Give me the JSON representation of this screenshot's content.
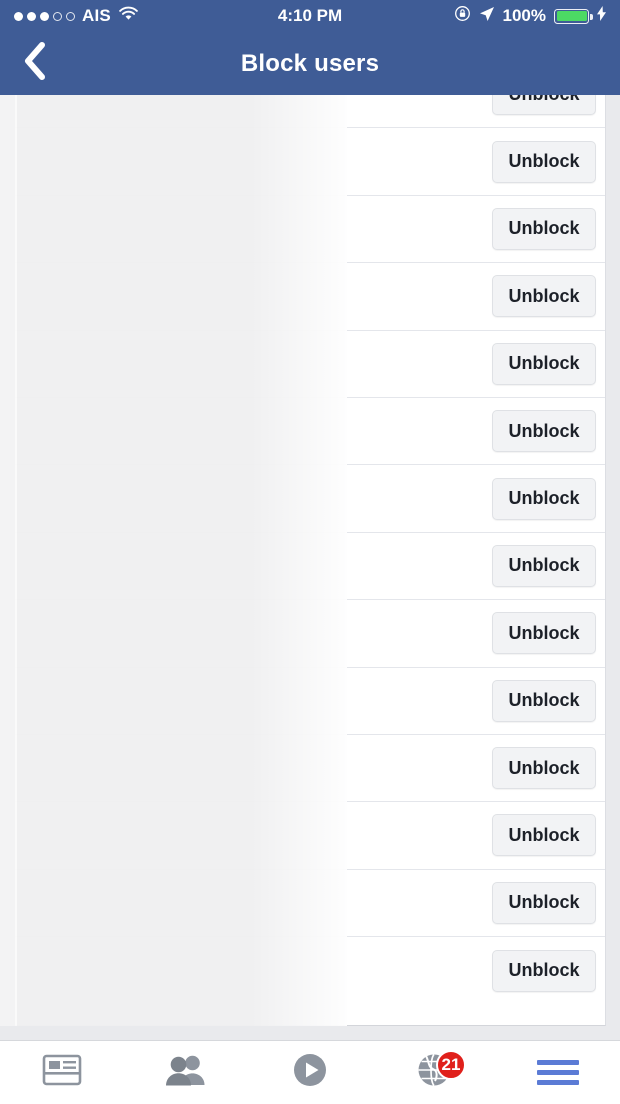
{
  "statusbar": {
    "carrier": "AIS",
    "signal_dots_filled": 3,
    "signal_dots_total": 5,
    "wifi_icon": "wifi-icon",
    "time": "4:10 PM",
    "rotation_lock_icon": "rotation-lock-icon",
    "location_icon": "location-arrow-icon",
    "battery_percent": "100%",
    "battery_level": 100,
    "battery_color": "#4cd964",
    "charging_icon": "lightning-bolt-icon"
  },
  "navbar": {
    "back_icon": "chevron-left-icon",
    "title": "Block users",
    "background_color": "#3f5c96",
    "title_color": "#ffffff"
  },
  "list": {
    "button_label": "Unblock",
    "rows": [
      {
        "name": ""
      },
      {
        "name": ""
      },
      {
        "name": ""
      },
      {
        "name": ""
      },
      {
        "name": ""
      },
      {
        "name": ""
      },
      {
        "name": ""
      },
      {
        "name": ""
      },
      {
        "name": ""
      },
      {
        "name": ""
      },
      {
        "name": ""
      },
      {
        "name": ""
      },
      {
        "name": ""
      },
      {
        "name": ""
      }
    ]
  },
  "tabbar": {
    "tabs": [
      {
        "icon": "news-feed-icon",
        "label": "",
        "active": false,
        "badge": ""
      },
      {
        "icon": "friends-icon",
        "label": "",
        "active": false,
        "badge": ""
      },
      {
        "icon": "video-play-icon",
        "label": "",
        "active": false,
        "badge": ""
      },
      {
        "icon": "notifications-globe-icon",
        "label": "",
        "active": false,
        "badge": "21"
      },
      {
        "icon": "menu-hamburger-icon",
        "label": "",
        "active": true,
        "badge": ""
      }
    ],
    "active_color": "#5b7bd5",
    "inactive_color": "#8d949e",
    "badge_color": "#e0201b"
  }
}
